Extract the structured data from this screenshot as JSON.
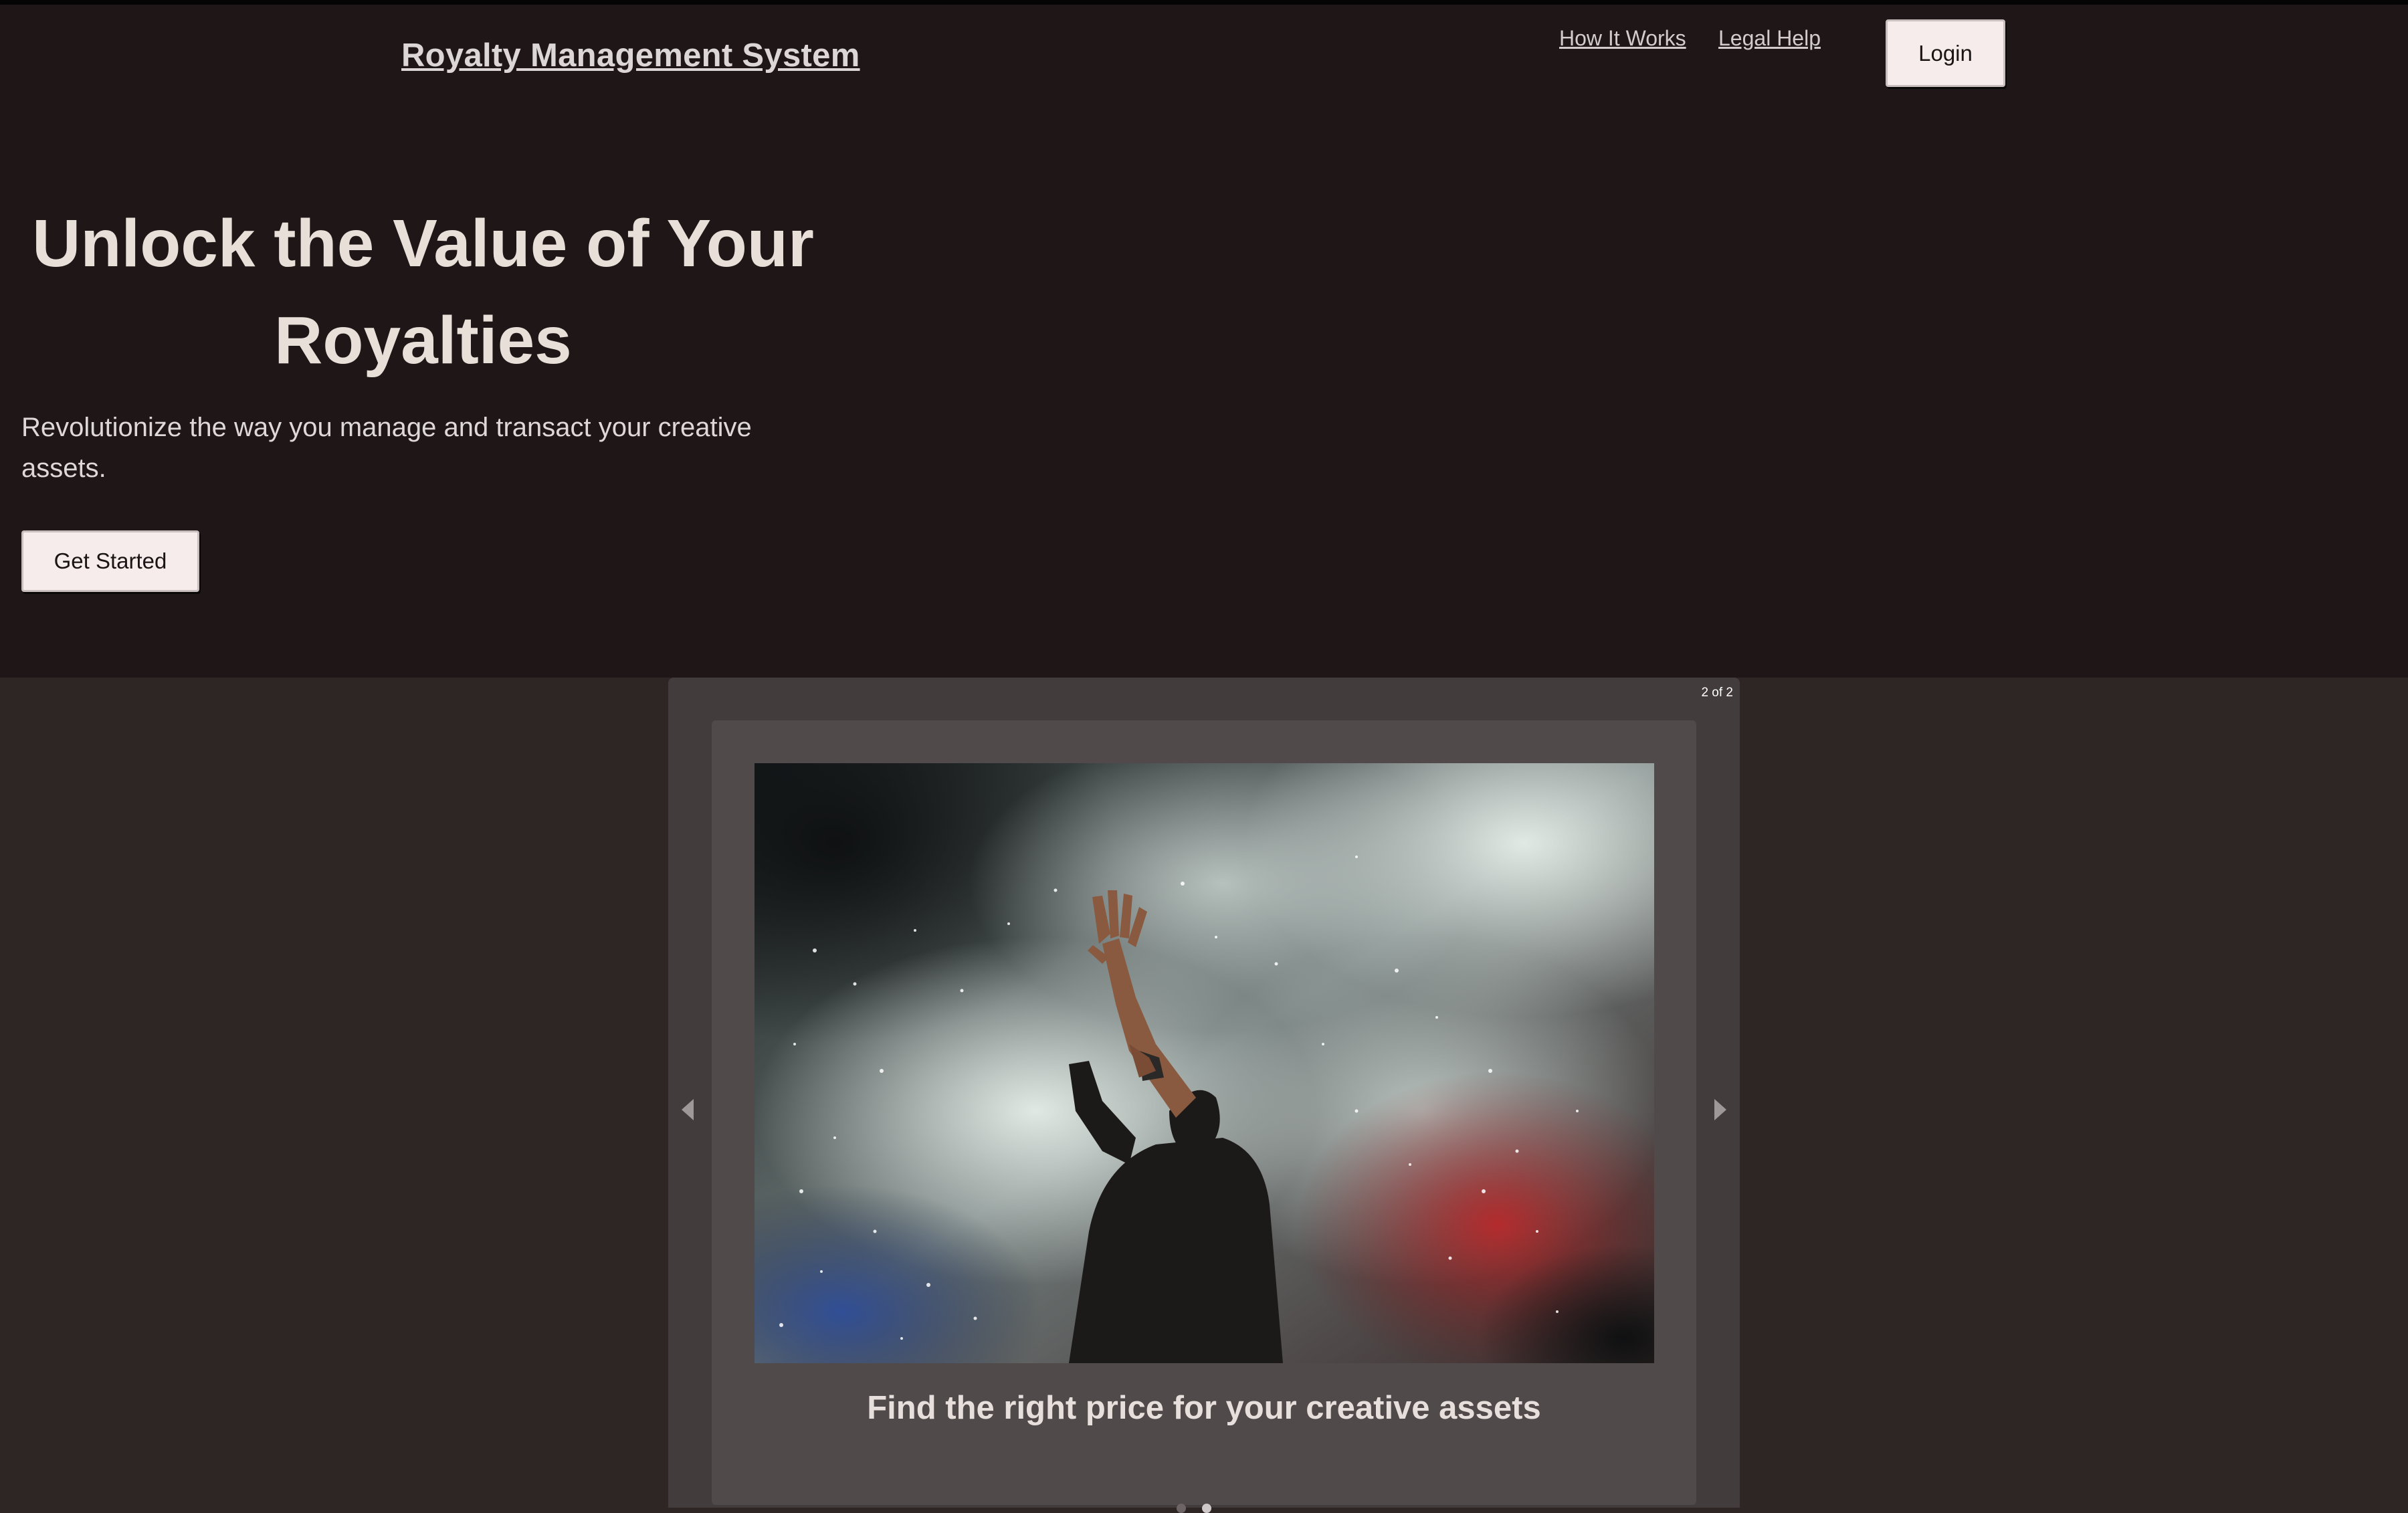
{
  "header": {
    "brand": "Royalty Management System",
    "nav": [
      {
        "label": "How It Works"
      },
      {
        "label": "Legal Help"
      }
    ],
    "login_label": "Login"
  },
  "hero": {
    "headline": "Unlock the Value of Your Royalties",
    "subtitle": "Revolutionize the way you manage and transact your creative assets.",
    "cta_label": "Get Started"
  },
  "carousel": {
    "counter": "2 of 2",
    "current_slide": 2,
    "total_slides": 2,
    "slide": {
      "caption": "Find the right price for your creative assets"
    },
    "prev_icon": "triangle-left",
    "next_icon": "triangle-right"
  },
  "colors": {
    "hero_bg": "#1f1717",
    "page_bg": "#2e2525",
    "carousel_bg": "#433c3c",
    "slide_bg": "#514a4a",
    "button_bg": "#f7ecec"
  }
}
